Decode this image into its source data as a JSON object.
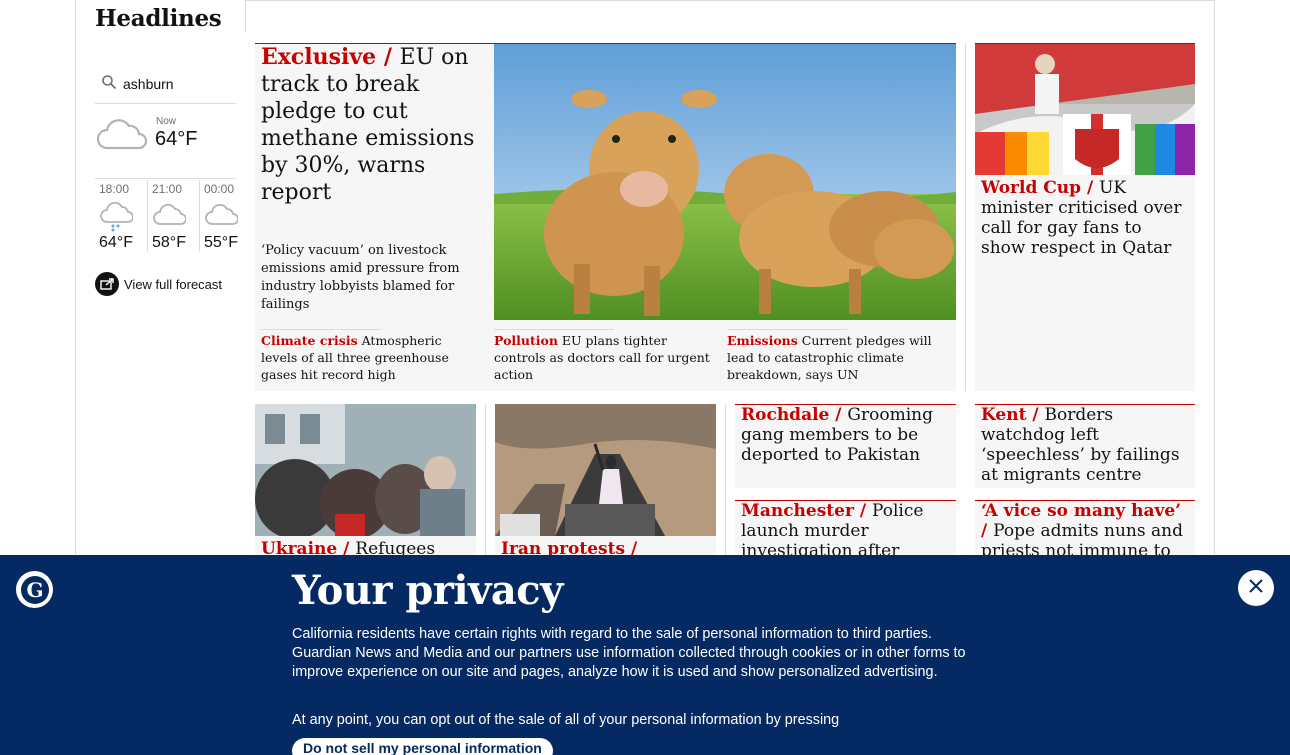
{
  "section": {
    "title": "Headlines"
  },
  "weather": {
    "search_value": "ashburn",
    "now_label": "Now",
    "now_temp": "64°F",
    "forecast": [
      {
        "time": "18:00",
        "temp": "64°F",
        "icon": "cloud-rain-icon"
      },
      {
        "time": "21:00",
        "temp": "58°F",
        "icon": "cloud-icon"
      },
      {
        "time": "00:00",
        "temp": "55°F",
        "icon": "cloud-icon"
      }
    ],
    "view_full_label": "View full forecast"
  },
  "main_story": {
    "kicker": "Exclusive /",
    "headline": "EU on track to break pledge to cut methane emissions by 30%, warns report",
    "standfirst": "‘Policy vacuum’ on livestock emissions amid pressure from industry lobbyists blamed for failings",
    "sublinks": [
      {
        "kicker": "Climate crisis",
        "text": "Atmospheric levels of all three greenhouse gases hit record high"
      },
      {
        "kicker": "Pollution",
        "text": "EU plans tighter controls as doctors call for urgent action"
      },
      {
        "kicker": "Emissions",
        "text": "Current pledges will lead to catastrophic climate breakdown, says UN"
      }
    ]
  },
  "stories": [
    {
      "kicker": "World Cup /",
      "headline": "UK minister criticised over call for gay fans to show respect in Qatar"
    },
    {
      "kicker": "Ukraine /",
      "headline": "Refugees"
    },
    {
      "kicker": "Iran protests /",
      "headline": ""
    },
    {
      "kicker": "Rochdale /",
      "headline": "Grooming gang members to be deported to Pakistan"
    },
    {
      "kicker": "Kent /",
      "headline": "Borders watchdog left ‘speechless’ by failings at migrants centre"
    },
    {
      "kicker": "Manchester /",
      "headline": "Police launch murder investigation after"
    },
    {
      "kicker": "‘A vice so many have’ /",
      "headline": "Pope admits nuns and priests not immune to"
    }
  ],
  "privacy": {
    "title": "Your privacy",
    "body": "California residents have certain rights with regard to the sale of personal information to third parties. Guardian News and Media and our partners use information collected through cookies or in other forms to improve experience on our site and pages, analyze how it is used and show personalized advertising.",
    "body2": "At any point, you can opt out of the sale of all of your personal information by pressing",
    "button_label": "Do not sell my personal information"
  },
  "colors": {
    "accent": "#c70000",
    "banner_bg": "#052962"
  }
}
